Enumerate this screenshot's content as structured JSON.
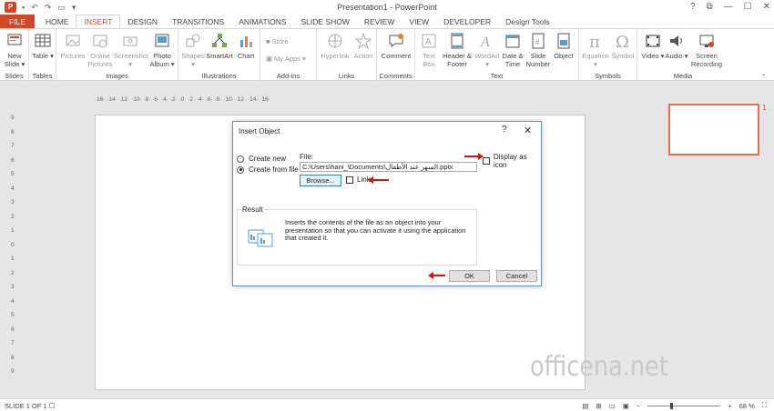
{
  "window": {
    "title": "Presentation1 - PowerPoint",
    "app_icon_letter": "P",
    "controls": [
      "?",
      "⧉",
      "—",
      "☐",
      "✕"
    ]
  },
  "tabs": [
    {
      "label": "FILE",
      "kind": "file"
    },
    {
      "label": "HOME",
      "kind": ""
    },
    {
      "label": "INSERT",
      "kind": "active"
    },
    {
      "label": "DESIGN",
      "kind": ""
    },
    {
      "label": "TRANSITIONS",
      "kind": ""
    },
    {
      "label": "ANIMATIONS",
      "kind": ""
    },
    {
      "label": "SLIDE SHOW",
      "kind": ""
    },
    {
      "label": "REVIEW",
      "kind": ""
    },
    {
      "label": "VIEW",
      "kind": ""
    },
    {
      "label": "DEVELOPER",
      "kind": ""
    },
    {
      "label": "Design Tools",
      "kind": ""
    }
  ],
  "ribbon": {
    "groups": {
      "slides": "Slides",
      "tables": "Tables",
      "images": "Images",
      "illustrations": "Illustrations",
      "addins": "Add-ins",
      "links": "Links",
      "comments": "Comments",
      "text": "Text",
      "symbols": "Symbols",
      "media": "Media"
    },
    "buttons": {
      "new_slide": "New Slide ▾",
      "table": "Table ▾",
      "pictures": "Pictures",
      "online_pictures": "Online Pictures",
      "screenshot": "Screenshot ▾",
      "photo_album": "Photo Album ▾",
      "shapes": "Shapes ▾",
      "smartart": "SmartArt",
      "chart": "Chart",
      "store": "Store",
      "my_apps": "My Apps ▾",
      "hyperlink": "Hyperlink",
      "action": "Action",
      "comment": "Comment",
      "text_box": "Text Box",
      "header_footer": "Header & Footer",
      "wordart": "WordArt ▾",
      "date_time": "Date & Time",
      "slide_number": "Slide Number",
      "object": "Object",
      "equation": "Equation ▾",
      "symbol": "Symbol",
      "video": "Video ▾",
      "audio": "Audio ▾",
      "screen_recording": "Screen Recording"
    }
  },
  "ruler": {
    "horizontal": "·16· ·14· ·12· ·10· ·8· ·6· ·4· ·2· ·0· ·2· ·4· ·6· ·8· ·10· ·12· ·14· ·16·",
    "vertical": [
      "9",
      "8",
      "7",
      "6",
      "5",
      "4",
      "3",
      "2",
      "1",
      "0",
      "1",
      "2",
      "3",
      "4",
      "5",
      "6",
      "7",
      "8",
      "9"
    ]
  },
  "thumbnail": {
    "number": "1"
  },
  "dialog": {
    "title": "Insert Object",
    "help": "?",
    "close": "✕",
    "create_new": "Create new",
    "create_from_file": "Create from file",
    "file_label": "File:",
    "file_path": "C:\\Users\\hani_\\Documents\\السهر عند الأطفال.pptx",
    "browse": "Browse...",
    "link": "Link",
    "display_as_icon": "Display as icon",
    "result_label": "Result",
    "result_text": "Inserts the contents of the file as an object into your presentation so that you can activate it using the application that created it.",
    "ok": "OK",
    "cancel": "Cancel"
  },
  "watermark": "officena.net",
  "status": {
    "slide": "SLIDE 1 OF 1",
    "zoom": "68 %",
    "zoom_percent": 68
  },
  "colors": {
    "accent": "#d24726",
    "arrow": "#e01010",
    "thumb_border": "#e66e4e"
  }
}
